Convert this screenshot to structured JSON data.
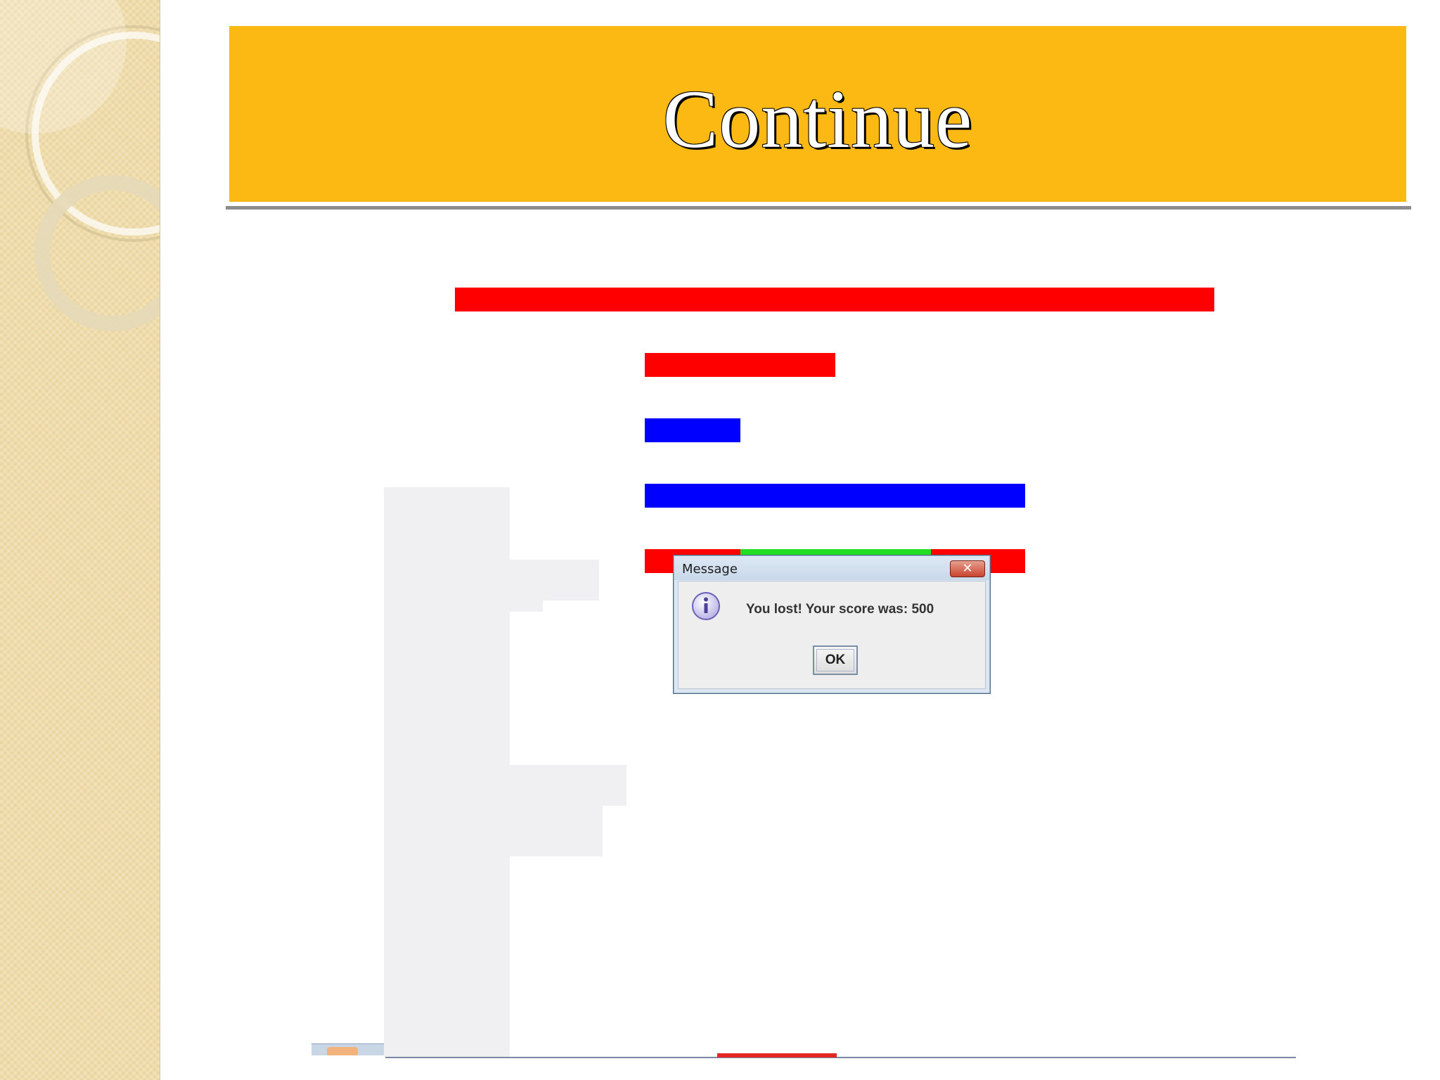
{
  "slide": {
    "title": "Continue"
  },
  "dialog": {
    "title": "Message",
    "close_glyph": "✕",
    "icon": "info-icon",
    "message": "You lost! Your score was: 500",
    "ok_label": "OK"
  },
  "colors": {
    "banner": "#fdb913",
    "brick_red": "#ff0000",
    "brick_blue": "#0000ff",
    "brick_green": "#22dd22"
  }
}
